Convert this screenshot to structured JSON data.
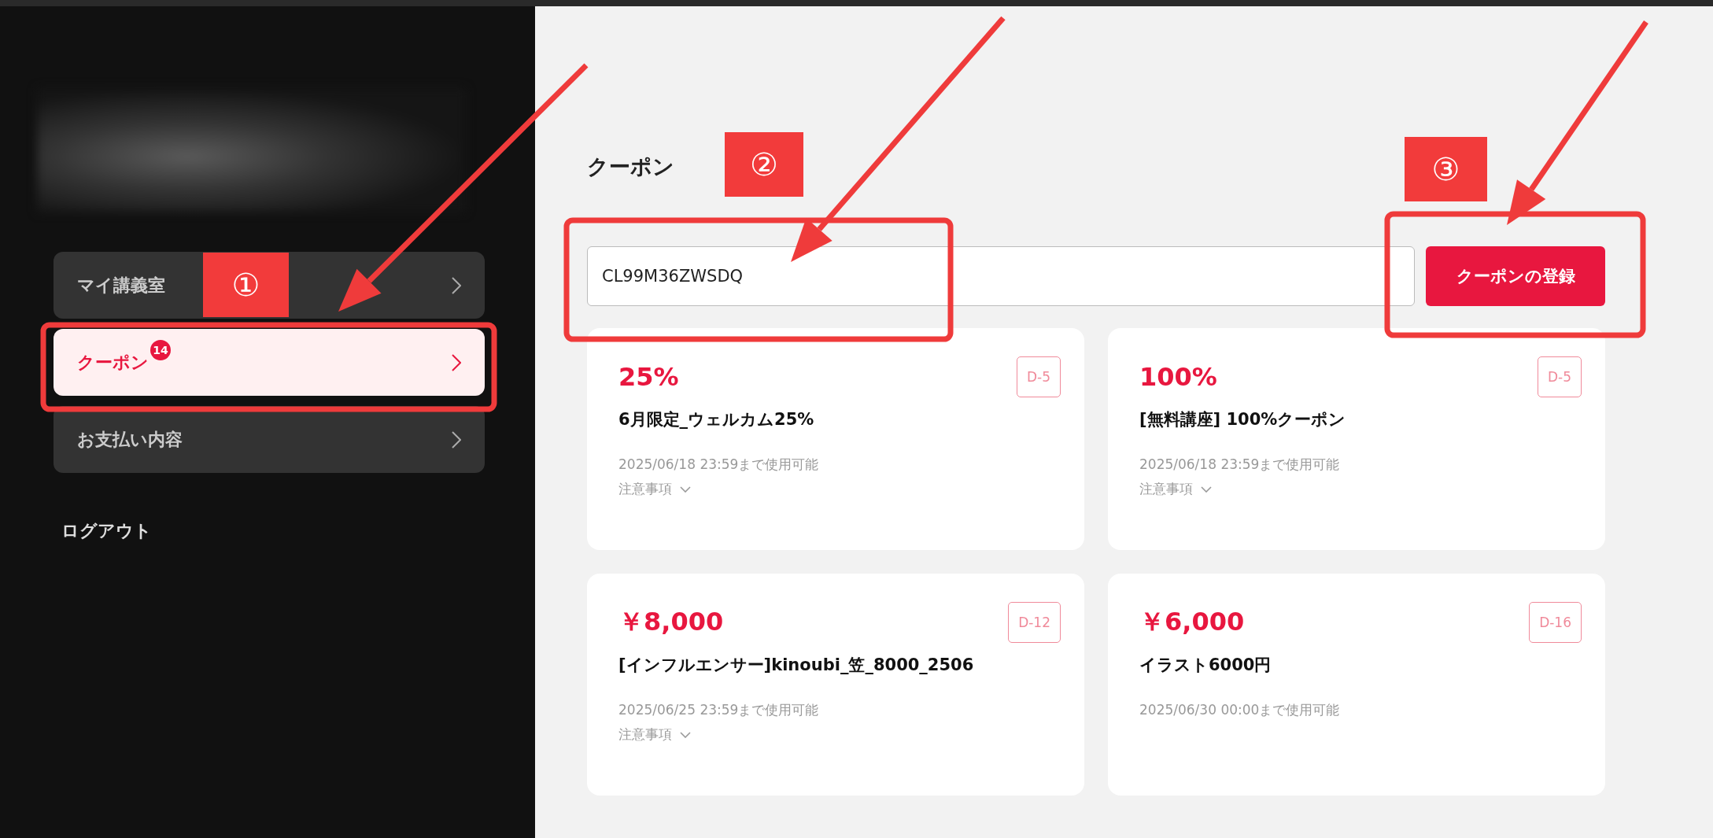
{
  "sidebar": {
    "menu": [
      {
        "label": "マイ講義室",
        "selected": false
      },
      {
        "label": "クーポン",
        "selected": true,
        "badge": "14"
      },
      {
        "label": "お支払い内容",
        "selected": false
      }
    ],
    "logout": "ログアウト"
  },
  "page": {
    "title": "クーポン",
    "code_input": {
      "value": "CL99M36ZWSDQ"
    },
    "register_button": "クーポンの登録"
  },
  "coupons": [
    {
      "amount": "25%",
      "days_left": "D-5",
      "name": "6月限定_ウェルカム25%",
      "valid_until": "2025/06/18 23:59まで使用可能",
      "notes": "注意事項"
    },
    {
      "amount": "100%",
      "days_left": "D-5",
      "name": "[無料講座] 100%クーポン",
      "valid_until": "2025/06/18 23:59まで使用可能",
      "notes": "注意事項"
    },
    {
      "amount": "￥8,000",
      "days_left": "D-12",
      "name": "[インフルエンサー]kinoubi_笠_8000_2506",
      "valid_until": "2025/06/25 23:59まで使用可能",
      "notes": "注意事項"
    },
    {
      "amount": "￥6,000",
      "days_left": "D-16",
      "name": "イラスト6000円",
      "valid_until": "2025/06/30 00:00まで使用可能"
    }
  ],
  "annotations": [
    {
      "label": "①"
    },
    {
      "label": "②"
    },
    {
      "label": "③"
    }
  ]
}
